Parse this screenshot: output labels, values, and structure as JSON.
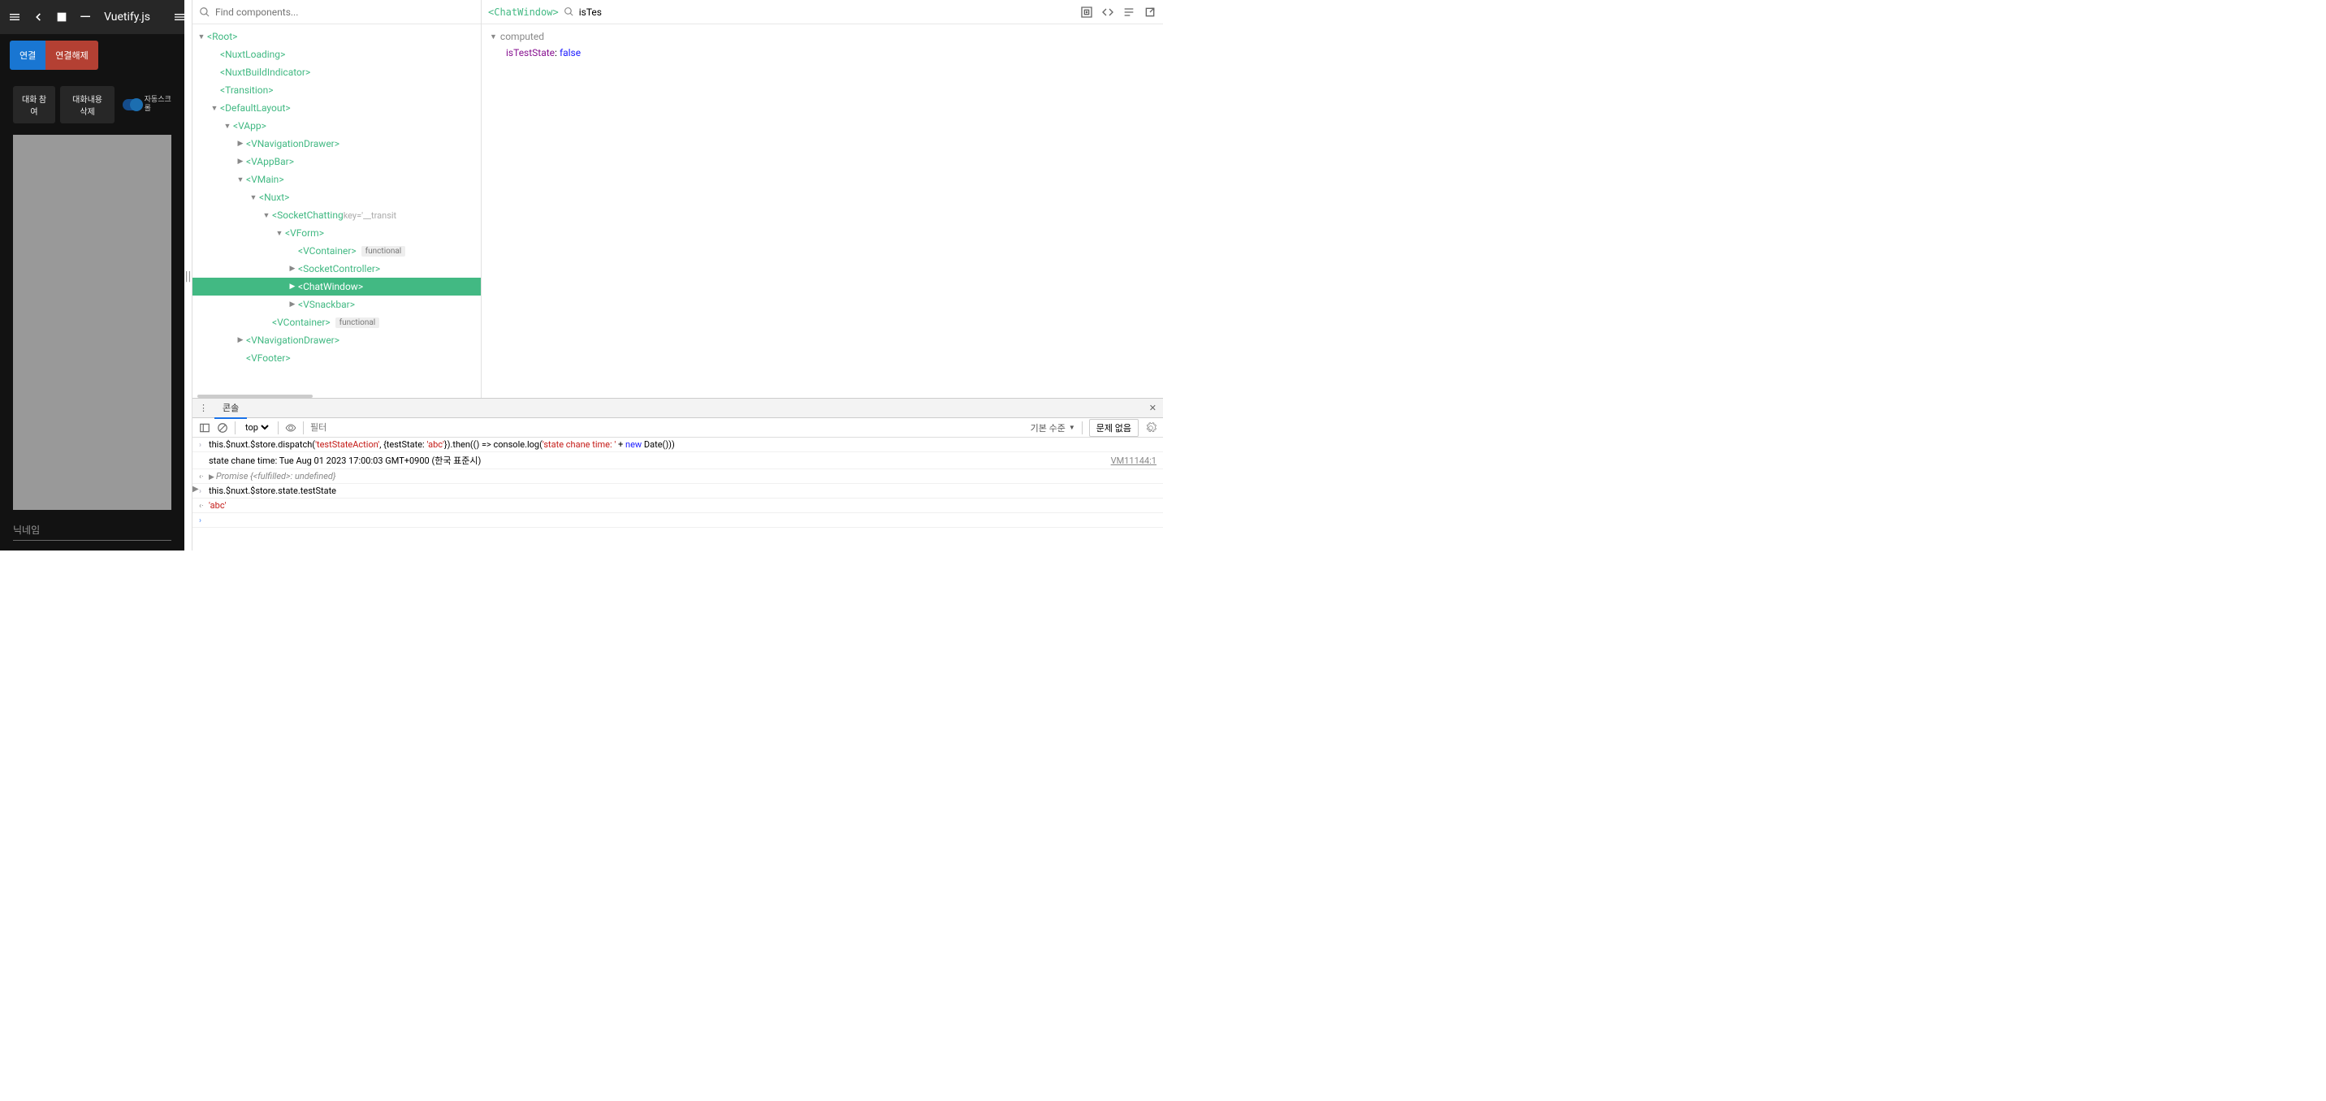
{
  "app": {
    "title": "Vuetify.js",
    "btn_connect": "연결",
    "btn_disconnect": "연결해제",
    "btn_join": "대화 참여",
    "btn_clear": "대화내용 삭제",
    "toggle_label": "자동스크롤",
    "nick_placeholder": "닉네임"
  },
  "tree": {
    "search_placeholder": "Find components...",
    "nodes": [
      {
        "depth": 0,
        "arrow": "down",
        "name": "Root"
      },
      {
        "depth": 1,
        "arrow": "none",
        "name": "NuxtLoading"
      },
      {
        "depth": 1,
        "arrow": "none",
        "name": "NuxtBuildIndicator"
      },
      {
        "depth": 1,
        "arrow": "none",
        "name": "Transition"
      },
      {
        "depth": 1,
        "arrow": "down",
        "name": "DefaultLayout"
      },
      {
        "depth": 2,
        "arrow": "down",
        "name": "VApp"
      },
      {
        "depth": 3,
        "arrow": "right",
        "name": "VNavigationDrawer"
      },
      {
        "depth": 3,
        "arrow": "right",
        "name": "VAppBar"
      },
      {
        "depth": 3,
        "arrow": "down",
        "name": "VMain"
      },
      {
        "depth": 4,
        "arrow": "down",
        "name": "Nuxt"
      },
      {
        "depth": 5,
        "arrow": "down",
        "name": "SocketChatting",
        "extra": "key='__transit"
      },
      {
        "depth": 6,
        "arrow": "down",
        "name": "VForm"
      },
      {
        "depth": 7,
        "arrow": "none",
        "name": "VContainer",
        "badge": "functional"
      },
      {
        "depth": 7,
        "arrow": "right",
        "name": "SocketController"
      },
      {
        "depth": 7,
        "arrow": "right",
        "name": "ChatWindow",
        "selected": true
      },
      {
        "depth": 7,
        "arrow": "right",
        "name": "VSnackbar"
      },
      {
        "depth": 5,
        "arrow": "none",
        "name": "VContainer",
        "badge": "functional"
      },
      {
        "depth": 3,
        "arrow": "right",
        "name": "VNavigationDrawer"
      },
      {
        "depth": 3,
        "arrow": "none",
        "name": "VFooter"
      }
    ]
  },
  "inspect": {
    "crumb": "<ChatWindow>",
    "filter_value": "isTes",
    "section": "computed",
    "prop_key": "isTestState",
    "prop_val": "false"
  },
  "console": {
    "tab": "콘솔",
    "context": "top",
    "filter_placeholder": "필터",
    "level_label": "기본 수준",
    "issues_label": "문제 없음",
    "line1_pre": "this.$nuxt.$store.dispatch(",
    "line1_s1": "'testStateAction'",
    "line1_mid": ", {testState: ",
    "line1_s2": "'abc'",
    "line1_mid2": "}).then(() => console.log(",
    "line1_s3": "'state chane time: '",
    "line1_mid3": " + ",
    "line1_kw": "new",
    "line1_post": " Date()))",
    "line2": "state chane time: Tue Aug 01 2023 17:00:03 GMT+0900 (한국 표준시)",
    "line2_src": "VM11144:1",
    "line3_a": "Promise {",
    "line3_b": "<fulfilled>",
    "line3_c": ": ",
    "line3_d": "undefined",
    "line3_e": "}",
    "line4": "this.$nuxt.$store.state.testState",
    "line5": "'abc'"
  }
}
